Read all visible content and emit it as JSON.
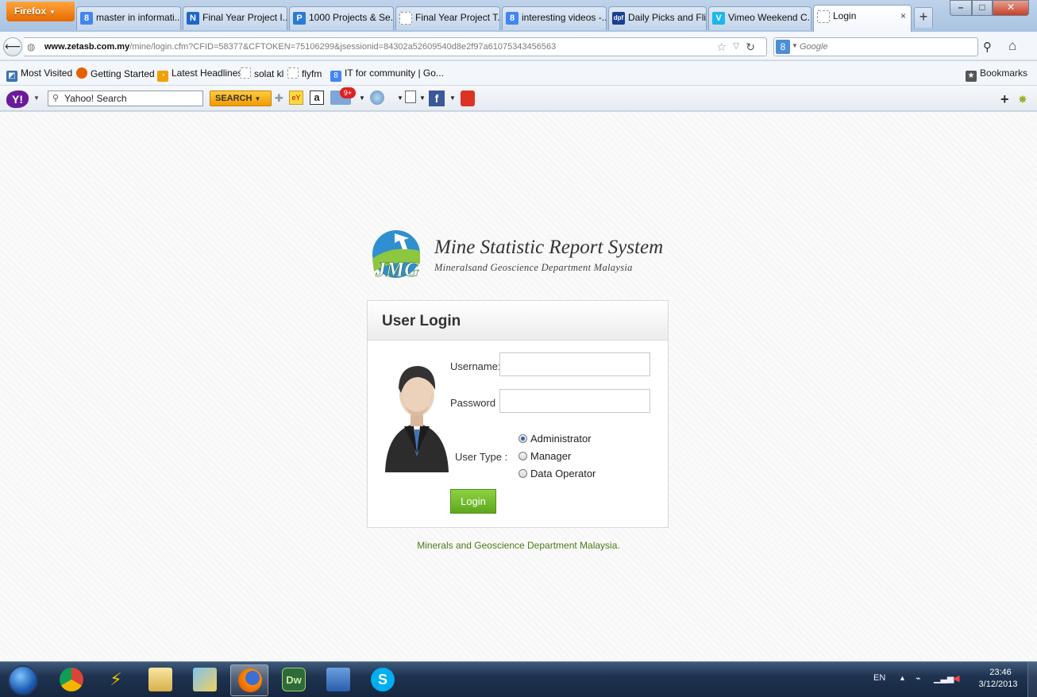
{
  "browser": {
    "menu_label": "Firefox",
    "tabs": [
      {
        "label": "master in informati...",
        "icon": "google-icon",
        "color": "#4285f4",
        "glyph": "8"
      },
      {
        "label": "Final Year Project I...",
        "icon": "site-icon",
        "color": "#1e66c9",
        "glyph": "N"
      },
      {
        "label": "1000 Projects & Se...",
        "icon": "p-icon",
        "color": "#2a7bd4",
        "glyph": "P"
      },
      {
        "label": "Final Year Project T...",
        "icon": "blank-page-icon",
        "color": "#ffffff",
        "glyph": ""
      },
      {
        "label": "interesting videos -...",
        "icon": "google-icon",
        "color": "#4285f4",
        "glyph": "8"
      },
      {
        "label": "Daily Picks and Flic...",
        "icon": "dpf-icon",
        "color": "#1a3f8f",
        "glyph": "dpf"
      },
      {
        "label": "Vimeo Weekend C...",
        "icon": "vimeo-icon",
        "color": "#1ab7ea",
        "glyph": "V"
      },
      {
        "label": "Login",
        "icon": "blank-page-icon",
        "color": "#ffffff",
        "glyph": ""
      }
    ],
    "tab_close": "×",
    "new_tab": "+",
    "url_domain": "www.zetasb.com.my",
    "url_path": "/mine/login.cfm?CFID=58377&CFTOKEN=75106299&jsessionid=84302a52609540d8e2f97a61075343456563",
    "search_placeholder": "Google",
    "bookmarks": [
      {
        "label": "Most Visited",
        "icon": "most-visited-icon",
        "color": "#3b6fb6"
      },
      {
        "label": "Getting Started",
        "icon": "firefox-icon",
        "color": "#e66000"
      },
      {
        "label": "Latest Headlines",
        "icon": "rss-icon",
        "color": "#f0a000"
      },
      {
        "label": "solat kl",
        "icon": "blank-page-icon",
        "color": "#ffffff"
      },
      {
        "label": "flyfm",
        "icon": "blank-page-icon",
        "color": "#ffffff"
      },
      {
        "label": "IT for community | Go...",
        "icon": "google-icon",
        "color": "#4285f4"
      }
    ],
    "bookmarks_menu": "Bookmarks"
  },
  "yahoo_toolbar": {
    "search_value": "Yahoo! Search",
    "search_button": "SEARCH",
    "mail_badge": "9+"
  },
  "page": {
    "logo_title": "Mine Statistic Report System",
    "logo_subtitle": "Mineralsand Geoscience Department Malaysia",
    "login_title": "User Login",
    "username_label": "Username:",
    "password_label": "Password :",
    "user_type_label": "User Type :",
    "user_types": [
      "Administrator",
      "Manager",
      "Data Operator"
    ],
    "selected_user_type": "Administrator",
    "login_button": "Login",
    "footer": "Minerals and Geoscience Department Malaysia."
  },
  "taskbar": {
    "apps": [
      "chrome-icon",
      "winamp-icon",
      "file-explorer-icon",
      "folder-icon",
      "firefox-icon",
      "dreamweaver-icon",
      "network-icon",
      "skype-icon"
    ],
    "dreamweaver_label": "Dw",
    "skype_label": "S",
    "language": "EN",
    "time": "23:46",
    "date": "3/12/2013"
  }
}
